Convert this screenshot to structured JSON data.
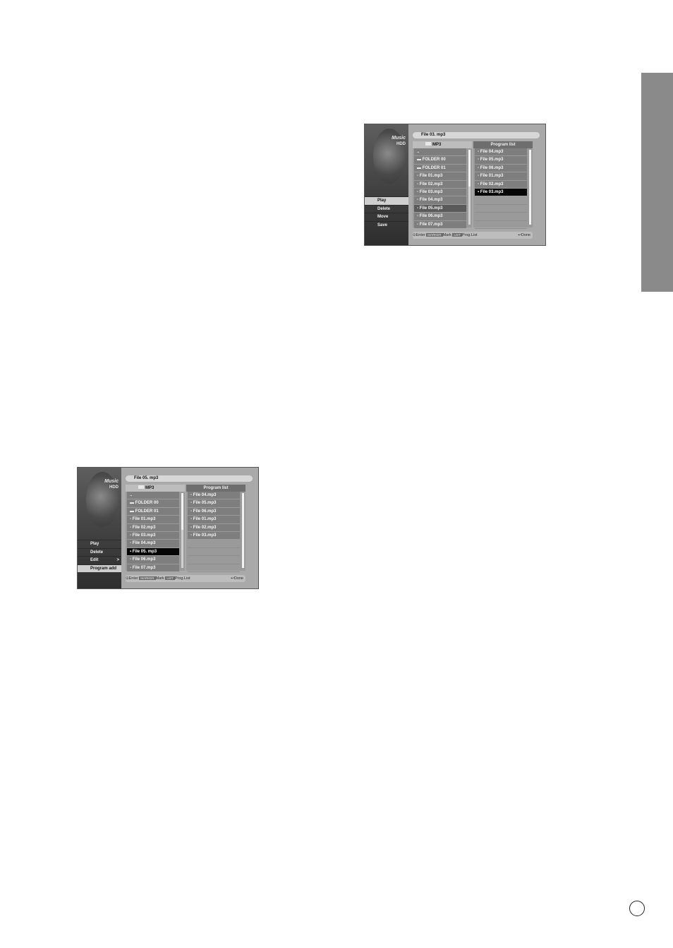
{
  "page_number": "",
  "screen1": {
    "logo": {
      "title": "Music",
      "sub": "HDD"
    },
    "file_title": "File 03. mp3",
    "menu": [
      {
        "label": "Play",
        "active": true
      },
      {
        "label": "Delete",
        "active": false
      },
      {
        "label": "Move",
        "active": false
      },
      {
        "label": "Save",
        "active": false
      }
    ],
    "folder_header": "MP3",
    "files": [
      "..",
      "FOLDER 00",
      "FOLDER 01",
      "File 01.mp3",
      "File 02.mp3",
      "File 03.mp3",
      "File 04.mp3",
      "File 05.mp3",
      "File 06.mp3",
      "File 07.mp3"
    ],
    "program_header": "Program list",
    "program_list": [
      "File 04.mp3",
      "File 05.mp3",
      "File 06.mp3",
      "File 01.mp3",
      "File 02.mp3",
      "File 03.mp3"
    ],
    "footer": {
      "enter": "Enter",
      "marker_key": "MARKER",
      "mark": "Mark",
      "list_key": "LIST",
      "prog_list": "Prog.List",
      "done": "Done"
    }
  },
  "screen2": {
    "logo": {
      "title": "Music",
      "sub": "HDD"
    },
    "file_title": "File 05. mp3",
    "menu": [
      {
        "label": "Play",
        "active": false
      },
      {
        "label": "Delete",
        "active": false
      },
      {
        "label": "Edit",
        "active": false
      },
      {
        "label": "Program add",
        "active": true
      }
    ],
    "edit_arrow": ">",
    "folder_header": "MP3",
    "files": [
      "..",
      "FOLDER 00",
      "FOLDER 01",
      "File 01.mp3",
      "File 02.mp3",
      "File 03.mp3",
      "File 04.mp3",
      "File 05. mp3",
      "File 06.mp3",
      "File 07.mp3"
    ],
    "program_header": "Program list",
    "program_list": [
      "File 04.mp3",
      "File 05.mp3",
      "File 06.mp3",
      "File 01.mp3",
      "File 02.mp3",
      "File 03.mp3"
    ],
    "footer": {
      "enter": "Enter",
      "marker_key": "MARKER",
      "mark": "Mark",
      "list_key": "LIST",
      "prog_list": "Prog.List",
      "done": "Done"
    }
  }
}
